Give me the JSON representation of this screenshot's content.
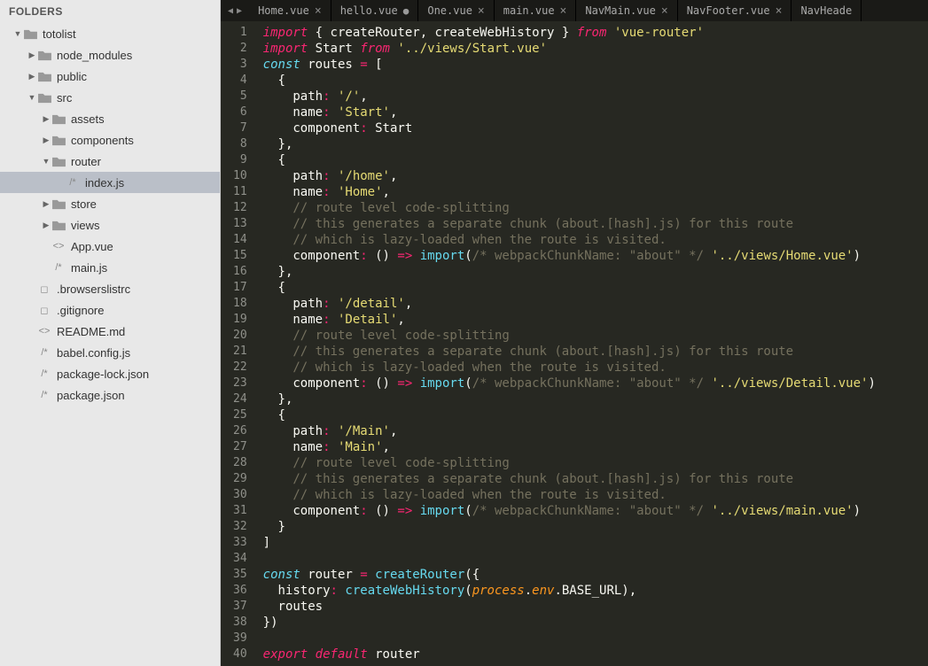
{
  "sidebar": {
    "header": "FOLDERS",
    "root": {
      "label": "totolist",
      "children": [
        {
          "label": "node_modules",
          "type": "folder",
          "expanded": false,
          "depth": 1
        },
        {
          "label": "public",
          "type": "folder",
          "expanded": false,
          "depth": 1
        },
        {
          "label": "src",
          "type": "folder",
          "expanded": true,
          "depth": 1
        },
        {
          "label": "assets",
          "type": "folder",
          "expanded": false,
          "depth": 2
        },
        {
          "label": "components",
          "type": "folder",
          "expanded": false,
          "depth": 2
        },
        {
          "label": "router",
          "type": "folder",
          "expanded": true,
          "depth": 2
        },
        {
          "label": "index.js",
          "type": "file",
          "kind": "js",
          "depth": 3,
          "selected": true
        },
        {
          "label": "store",
          "type": "folder",
          "expanded": false,
          "depth": 2
        },
        {
          "label": "views",
          "type": "folder",
          "expanded": false,
          "depth": 2
        },
        {
          "label": "App.vue",
          "type": "file",
          "kind": "vue",
          "depth": 2
        },
        {
          "label": "main.js",
          "type": "file",
          "kind": "js",
          "depth": 2
        },
        {
          "label": ".browserslistrc",
          "type": "file",
          "kind": "txt",
          "depth": 1
        },
        {
          "label": ".gitignore",
          "type": "file",
          "kind": "txt",
          "depth": 1
        },
        {
          "label": "README.md",
          "type": "file",
          "kind": "md",
          "depth": 1
        },
        {
          "label": "babel.config.js",
          "type": "file",
          "kind": "js",
          "depth": 1
        },
        {
          "label": "package-lock.json",
          "type": "file",
          "kind": "js",
          "depth": 1
        },
        {
          "label": "package.json",
          "type": "file",
          "kind": "js",
          "depth": 1
        }
      ]
    }
  },
  "tabs": [
    {
      "label": "Home.vue",
      "dirty": false
    },
    {
      "label": "hello.vue",
      "dirty": true
    },
    {
      "label": "One.vue",
      "dirty": false
    },
    {
      "label": "main.vue",
      "dirty": false
    },
    {
      "label": "NavMain.vue",
      "dirty": false
    },
    {
      "label": "NavFooter.vue",
      "dirty": false
    },
    {
      "label": "NavHeade",
      "dirty": false,
      "truncated": true
    }
  ],
  "code": {
    "lines": [
      [
        [
          "kw",
          "import"
        ],
        [
          "punc",
          " { "
        ],
        [
          "ident",
          "createRouter"
        ],
        [
          "punc",
          ", "
        ],
        [
          "ident",
          "createWebHistory"
        ],
        [
          "punc",
          " } "
        ],
        [
          "kw",
          "from"
        ],
        [
          "punc",
          " "
        ],
        [
          "str",
          "'vue-router'"
        ]
      ],
      [
        [
          "kw",
          "import"
        ],
        [
          "punc",
          " "
        ],
        [
          "ident",
          "Start"
        ],
        [
          "punc",
          " "
        ],
        [
          "kw",
          "from"
        ],
        [
          "punc",
          " "
        ],
        [
          "str",
          "'../views/Start.vue'"
        ]
      ],
      [
        [
          "decl",
          "const"
        ],
        [
          "punc",
          " "
        ],
        [
          "ident",
          "routes"
        ],
        [
          "punc",
          " "
        ],
        [
          "kw2",
          "="
        ],
        [
          "punc",
          " ["
        ]
      ],
      [
        [
          "punc",
          "  {"
        ]
      ],
      [
        [
          "punc",
          "    "
        ],
        [
          "ident",
          "path"
        ],
        [
          "kw2",
          ":"
        ],
        [
          "punc",
          " "
        ],
        [
          "str",
          "'/'"
        ],
        [
          "punc",
          ","
        ]
      ],
      [
        [
          "punc",
          "    "
        ],
        [
          "ident",
          "name"
        ],
        [
          "kw2",
          ":"
        ],
        [
          "punc",
          " "
        ],
        [
          "str",
          "'Start'"
        ],
        [
          "punc",
          ","
        ]
      ],
      [
        [
          "punc",
          "    "
        ],
        [
          "ident",
          "component"
        ],
        [
          "kw2",
          ":"
        ],
        [
          "punc",
          " "
        ],
        [
          "ident",
          "Start"
        ]
      ],
      [
        [
          "punc",
          "  },"
        ]
      ],
      [
        [
          "punc",
          "  {"
        ]
      ],
      [
        [
          "punc",
          "    "
        ],
        [
          "ident",
          "path"
        ],
        [
          "kw2",
          ":"
        ],
        [
          "punc",
          " "
        ],
        [
          "str",
          "'/home'"
        ],
        [
          "punc",
          ","
        ]
      ],
      [
        [
          "punc",
          "    "
        ],
        [
          "ident",
          "name"
        ],
        [
          "kw2",
          ":"
        ],
        [
          "punc",
          " "
        ],
        [
          "str",
          "'Home'"
        ],
        [
          "punc",
          ","
        ]
      ],
      [
        [
          "punc",
          "    "
        ],
        [
          "cmt",
          "// route level code-splitting"
        ]
      ],
      [
        [
          "punc",
          "    "
        ],
        [
          "cmt",
          "// this generates a separate chunk (about.[hash].js) for this route"
        ]
      ],
      [
        [
          "punc",
          "    "
        ],
        [
          "cmt",
          "// which is lazy-loaded when the route is visited."
        ]
      ],
      [
        [
          "punc",
          "    "
        ],
        [
          "ident",
          "component"
        ],
        [
          "kw2",
          ":"
        ],
        [
          "punc",
          " "
        ],
        [
          "punc",
          "()"
        ],
        [
          "punc",
          " "
        ],
        [
          "kw2",
          "=>"
        ],
        [
          "punc",
          " "
        ],
        [
          "fn",
          "import"
        ],
        [
          "punc",
          "("
        ],
        [
          "cmt",
          "/* webpackChunkName: \"about\" */"
        ],
        [
          "punc",
          " "
        ],
        [
          "str",
          "'../views/Home.vue'"
        ],
        [
          "punc",
          ")"
        ]
      ],
      [
        [
          "punc",
          "  },"
        ]
      ],
      [
        [
          "punc",
          "  {"
        ]
      ],
      [
        [
          "punc",
          "    "
        ],
        [
          "ident",
          "path"
        ],
        [
          "kw2",
          ":"
        ],
        [
          "punc",
          " "
        ],
        [
          "str",
          "'/detail'"
        ],
        [
          "punc",
          ","
        ]
      ],
      [
        [
          "punc",
          "    "
        ],
        [
          "ident",
          "name"
        ],
        [
          "kw2",
          ":"
        ],
        [
          "punc",
          " "
        ],
        [
          "str",
          "'Detail'"
        ],
        [
          "punc",
          ","
        ]
      ],
      [
        [
          "punc",
          "    "
        ],
        [
          "cmt",
          "// route level code-splitting"
        ]
      ],
      [
        [
          "punc",
          "    "
        ],
        [
          "cmt",
          "// this generates a separate chunk (about.[hash].js) for this route"
        ]
      ],
      [
        [
          "punc",
          "    "
        ],
        [
          "cmt",
          "// which is lazy-loaded when the route is visited."
        ]
      ],
      [
        [
          "punc",
          "    "
        ],
        [
          "ident",
          "component"
        ],
        [
          "kw2",
          ":"
        ],
        [
          "punc",
          " "
        ],
        [
          "punc",
          "()"
        ],
        [
          "punc",
          " "
        ],
        [
          "kw2",
          "=>"
        ],
        [
          "punc",
          " "
        ],
        [
          "fn",
          "import"
        ],
        [
          "punc",
          "("
        ],
        [
          "cmt",
          "/* webpackChunkName: \"about\" */"
        ],
        [
          "punc",
          " "
        ],
        [
          "str",
          "'../views/Detail.vue'"
        ],
        [
          "punc",
          ")"
        ]
      ],
      [
        [
          "punc",
          "  },"
        ]
      ],
      [
        [
          "punc",
          "  {"
        ]
      ],
      [
        [
          "punc",
          "    "
        ],
        [
          "ident",
          "path"
        ],
        [
          "kw2",
          ":"
        ],
        [
          "punc",
          " "
        ],
        [
          "str",
          "'/Main'"
        ],
        [
          "punc",
          ","
        ]
      ],
      [
        [
          "punc",
          "    "
        ],
        [
          "ident",
          "name"
        ],
        [
          "kw2",
          ":"
        ],
        [
          "punc",
          " "
        ],
        [
          "str",
          "'Main'"
        ],
        [
          "punc",
          ","
        ]
      ],
      [
        [
          "punc",
          "    "
        ],
        [
          "cmt",
          "// route level code-splitting"
        ]
      ],
      [
        [
          "punc",
          "    "
        ],
        [
          "cmt",
          "// this generates a separate chunk (about.[hash].js) for this route"
        ]
      ],
      [
        [
          "punc",
          "    "
        ],
        [
          "cmt",
          "// which is lazy-loaded when the route is visited."
        ]
      ],
      [
        [
          "punc",
          "    "
        ],
        [
          "ident",
          "component"
        ],
        [
          "kw2",
          ":"
        ],
        [
          "punc",
          " "
        ],
        [
          "punc",
          "()"
        ],
        [
          "punc",
          " "
        ],
        [
          "kw2",
          "=>"
        ],
        [
          "punc",
          " "
        ],
        [
          "fn",
          "import"
        ],
        [
          "punc",
          "("
        ],
        [
          "cmt",
          "/* webpackChunkName: \"about\" */"
        ],
        [
          "punc",
          " "
        ],
        [
          "str",
          "'../views/main.vue'"
        ],
        [
          "punc",
          ")"
        ]
      ],
      [
        [
          "punc",
          "  }"
        ]
      ],
      [
        [
          "punc",
          "]"
        ]
      ],
      [],
      [
        [
          "decl",
          "const"
        ],
        [
          "punc",
          " "
        ],
        [
          "ident",
          "router"
        ],
        [
          "punc",
          " "
        ],
        [
          "kw2",
          "="
        ],
        [
          "punc",
          " "
        ],
        [
          "fn",
          "createRouter"
        ],
        [
          "punc",
          "({"
        ]
      ],
      [
        [
          "punc",
          "  "
        ],
        [
          "ident",
          "history"
        ],
        [
          "kw2",
          ":"
        ],
        [
          "punc",
          " "
        ],
        [
          "fn",
          "createWebHistory"
        ],
        [
          "punc",
          "("
        ],
        [
          "param",
          "process"
        ],
        [
          "punc",
          "."
        ],
        [
          "param",
          "env"
        ],
        [
          "punc",
          ".BASE_URL),"
        ]
      ],
      [
        [
          "punc",
          "  "
        ],
        [
          "ident",
          "routes"
        ]
      ],
      [
        [
          "punc",
          "})"
        ]
      ],
      [],
      [
        [
          "kw",
          "export"
        ],
        [
          "punc",
          " "
        ],
        [
          "kw",
          "default"
        ],
        [
          "punc",
          " "
        ],
        [
          "ident",
          "router"
        ]
      ]
    ]
  }
}
